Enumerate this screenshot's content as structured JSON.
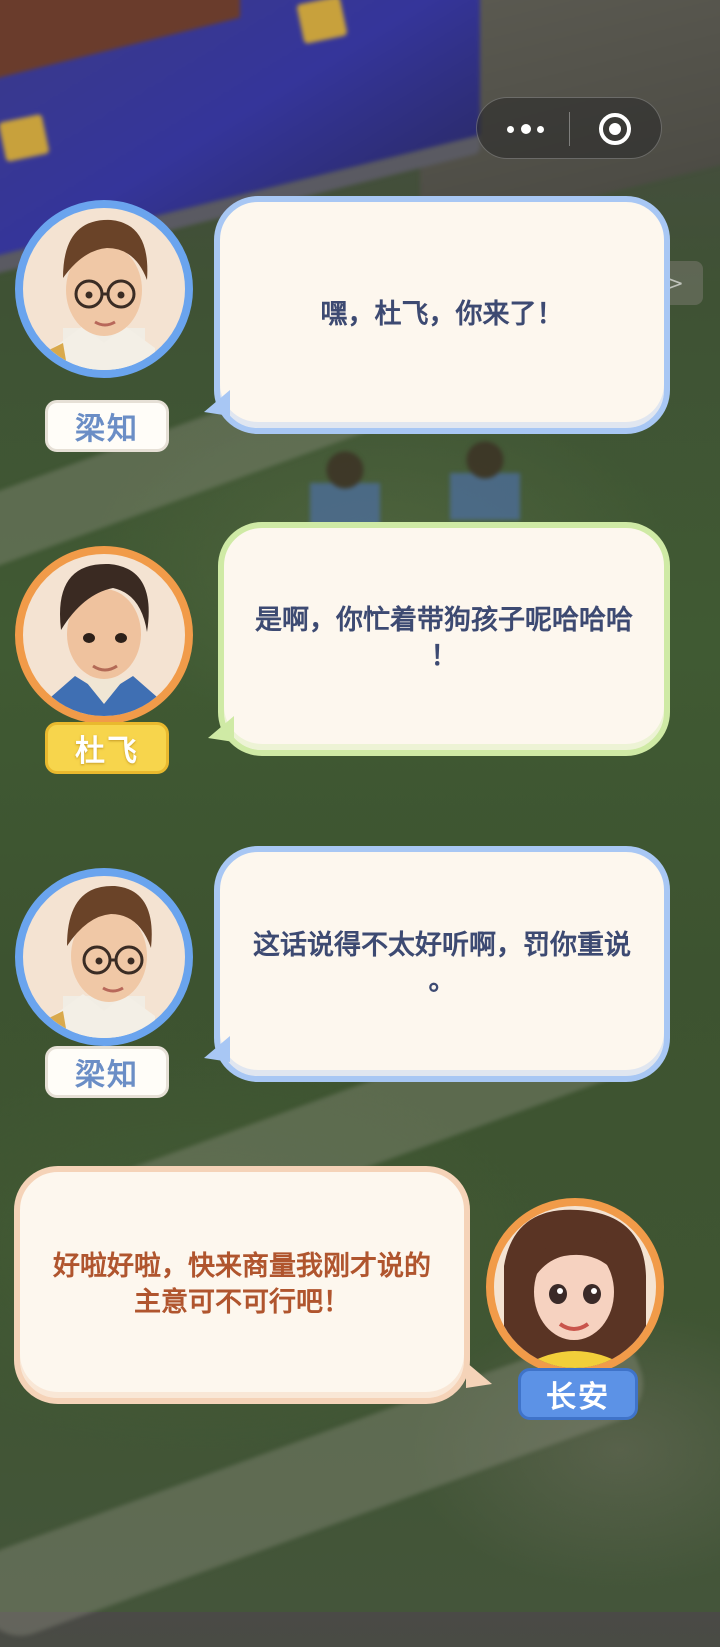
{
  "capsule": {
    "more_icon": "more-dots-icon",
    "close_icon": "target-close-icon"
  },
  "skip": {
    "label": ">>"
  },
  "dialogue": [
    {
      "speaker": "梁知",
      "text": "嘿，杜飞，你来了！",
      "side": "left",
      "avatar_color": "#6aa4ee",
      "bubble_color": "#a8c7f4"
    },
    {
      "speaker": "杜飞",
      "text": "是啊，你忙着带狗孩子呢哈哈哈\n！",
      "side": "left",
      "avatar_color": "#f19b49",
      "bubble_color": "#cfeaa5"
    },
    {
      "speaker": "梁知",
      "text": "这话说得不太好听啊，罚你重说\n。",
      "side": "left",
      "avatar_color": "#6aa4ee",
      "bubble_color": "#a8c7f4"
    },
    {
      "speaker": "长安",
      "text": "好啦好啦，快来商量我刚才说的\n主意可不可行吧！",
      "side": "right",
      "avatar_color": "#f19b49",
      "bubble_color": "#f5d3b8"
    }
  ]
}
